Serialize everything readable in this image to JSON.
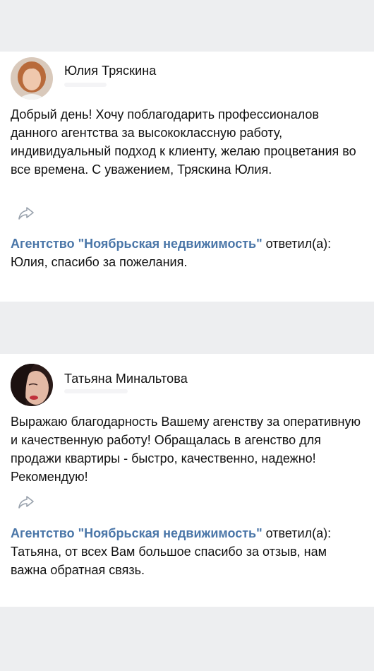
{
  "reviews": [
    {
      "author": "Юлия Тряскина",
      "text": "Добрый день! Хочу поблагодарить профессионалов данного агентства за высококлассную работу, индивидуальный подход к клиенту, желаю процветания во все времена. С уважением, Тряскина Юлия.",
      "share_icon": "share-arrow-icon",
      "reply": {
        "author": "Агентство \"Ноябрьская недвижимость\"",
        "action": " ответил(а): ",
        "text": "Юлия, спасибо за пожелания."
      }
    },
    {
      "author": "Татьяна Минальтова",
      "text": "Выражаю благодарность Вашему агенству за оперативную и качественную работу! Обращалась в агенство для продажи квартиры - быстро, качественно, надежно! Рекомендую!",
      "share_icon": "share-arrow-icon",
      "reply": {
        "author": "Агентство \"Ноябрьская недвижимость\"",
        "action": " ответил(а): ",
        "text": "Татьяна, от всех Вам большое спасибо за отзыв, нам важна обратная связь."
      }
    }
  ],
  "colors": {
    "background": "#edeef0",
    "card": "#ffffff",
    "link": "#4a76a8",
    "icon": "#99a2ad"
  }
}
